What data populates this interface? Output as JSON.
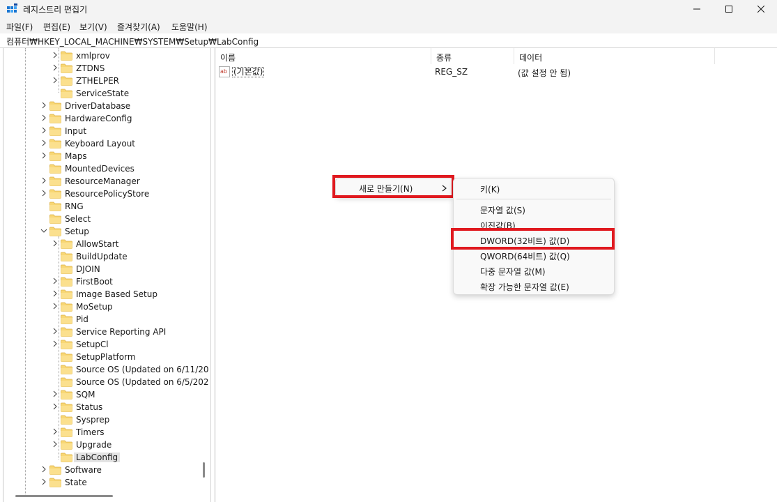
{
  "window": {
    "title": "레지스트리 편집기",
    "icon": "regedit-app-icon"
  },
  "menubar": {
    "items": [
      "파일(F)",
      "편집(E)",
      "보기(V)",
      "즐겨찾기(A)",
      "도움말(H)"
    ]
  },
  "address": {
    "path": "컴퓨터₩HKEY_LOCAL_MACHINE₩SYSTEM₩Setup₩LabConfig"
  },
  "tree": {
    "items": [
      {
        "label": "xmlprov",
        "expandable": true
      },
      {
        "label": "ZTDNS",
        "expandable": true
      },
      {
        "label": "ZTHELPER",
        "expandable": true
      },
      {
        "label": "ServiceState",
        "expandable": false
      },
      {
        "label": "DriverDatabase",
        "expandable": true
      },
      {
        "label": "HardwareConfig",
        "expandable": true
      },
      {
        "label": "Input",
        "expandable": true
      },
      {
        "label": "Keyboard Layout",
        "expandable": true
      },
      {
        "label": "Maps",
        "expandable": true
      },
      {
        "label": "MountedDevices",
        "expandable": false
      },
      {
        "label": "ResourceManager",
        "expandable": true
      },
      {
        "label": "ResourcePolicyStore",
        "expandable": true
      },
      {
        "label": "RNG",
        "expandable": false
      },
      {
        "label": "Select",
        "expandable": false
      },
      {
        "label": "Setup",
        "expandable": true,
        "expanded": true
      },
      {
        "label": "AllowStart",
        "expandable": true
      },
      {
        "label": "BuildUpdate",
        "expandable": false
      },
      {
        "label": "DJOIN",
        "expandable": false
      },
      {
        "label": "FirstBoot",
        "expandable": true
      },
      {
        "label": "Image Based Setup",
        "expandable": true
      },
      {
        "label": "MoSetup",
        "expandable": true
      },
      {
        "label": "Pid",
        "expandable": false
      },
      {
        "label": "Service Reporting API",
        "expandable": true
      },
      {
        "label": "SetupCl",
        "expandable": true
      },
      {
        "label": "SetupPlatform",
        "expandable": false
      },
      {
        "label": "Source OS (Updated on 6/11/20",
        "expandable": false
      },
      {
        "label": "Source OS (Updated on 6/5/202",
        "expandable": false
      },
      {
        "label": "SQM",
        "expandable": true
      },
      {
        "label": "Status",
        "expandable": true
      },
      {
        "label": "Sysprep",
        "expandable": false
      },
      {
        "label": "Timers",
        "expandable": true
      },
      {
        "label": "Upgrade",
        "expandable": true
      },
      {
        "label": "LabConfig",
        "expandable": false,
        "selected": true
      },
      {
        "label": "Software",
        "expandable": true
      },
      {
        "label": "State",
        "expandable": true
      }
    ]
  },
  "list": {
    "headers": [
      "이름",
      "종류",
      "데이터"
    ],
    "rows": [
      {
        "name": "(기본값)",
        "type": "REG_SZ",
        "data": "(값 설정 안 됨)"
      }
    ]
  },
  "context_menu": {
    "new_label": "새로 만들기(N)"
  },
  "submenu": {
    "items": [
      "키(K)",
      "문자열 값(S)",
      "이진값(B)",
      "DWORD(32비트) 값(D)",
      "QWORD(64비트) 값(Q)",
      "다중 문자열 값(M)",
      "확장 가능한 문자열 값(E)"
    ]
  },
  "highlight_color": "#e0191f"
}
